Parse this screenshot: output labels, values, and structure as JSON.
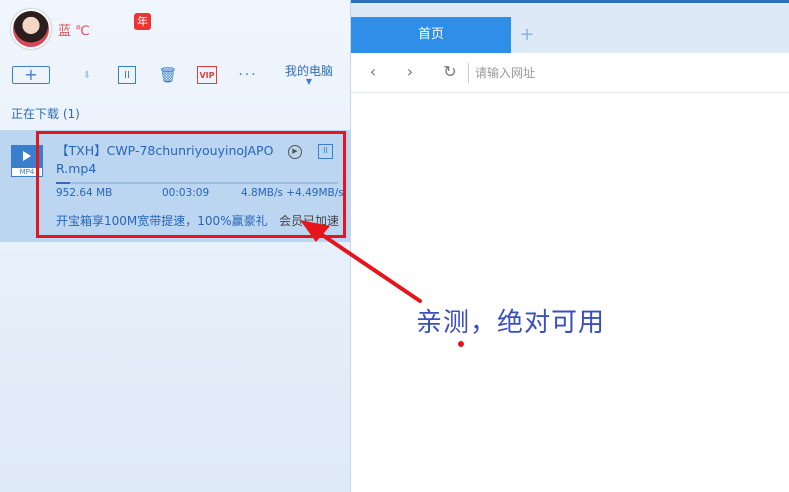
{
  "user": {
    "name": "蓝  ℃",
    "badge": "年"
  },
  "toolbar": {
    "new_label": "+",
    "pause_label": "II",
    "trash_label": "🗑",
    "vip_label": "VIP",
    "more_label": "···",
    "pc_label": "我的电脑"
  },
  "downloads": {
    "section_title": "正在下载 (1)",
    "item": {
      "ext": "MP4",
      "name": "【TXH】CWP-78chunriyouyinoJAPOR.mp4",
      "size": "952.64 MB",
      "time": "00:03:09",
      "speed": "4.8MB/s +4.49MB/s",
      "progress": 0.05,
      "promo": "开宝箱享100M宽带提速，100%赢豪礼",
      "accel": "会员已加速"
    }
  },
  "browser": {
    "tab_label": "首页",
    "add_tab": "+",
    "back": "‹",
    "forward": "›",
    "refresh": "↻",
    "url_placeholder": "请输入网址"
  },
  "annotation": {
    "text": "亲测，绝对可用",
    "colors": {
      "arrow": "#e8141c",
      "text": "#3a4fbf"
    }
  }
}
